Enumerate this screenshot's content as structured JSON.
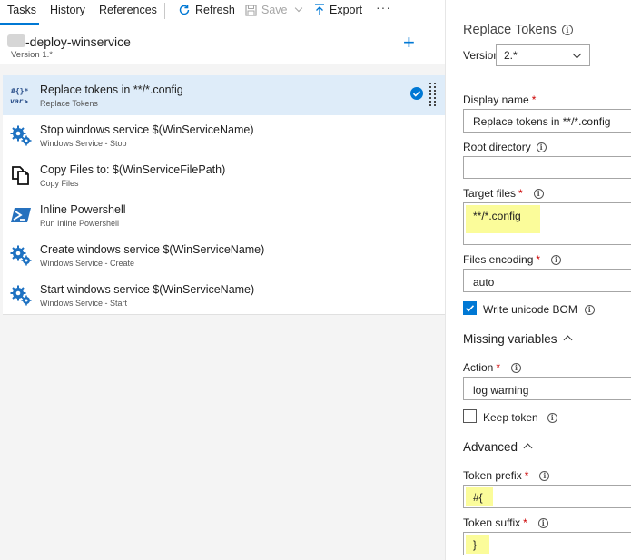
{
  "toolbar": {
    "tabs": [
      {
        "label": "Tasks",
        "active": true
      },
      {
        "label": "History",
        "active": false
      },
      {
        "label": "References",
        "active": false
      }
    ],
    "refresh_label": "Refresh",
    "save_label": "Save",
    "export_label": "Export",
    "more_label": "···"
  },
  "definition": {
    "name": "-deploy-winservice",
    "version": "Version 1.*",
    "add_label": "+"
  },
  "tasks": [
    {
      "title": "Replace tokens in **/*.config",
      "subtitle": "Replace Tokens",
      "icon": "replace-tokens-icon",
      "selected": true
    },
    {
      "title": "Stop windows service $(WinServiceName)",
      "subtitle": "Windows Service - Stop",
      "icon": "gears-icon",
      "selected": false
    },
    {
      "title": "Copy Files to: $(WinServiceFilePath)",
      "subtitle": "Copy Files",
      "icon": "copy-files-icon",
      "selected": false
    },
    {
      "title": "Inline Powershell",
      "subtitle": "Run Inline Powershell",
      "icon": "powershell-icon",
      "selected": false
    },
    {
      "title": "Create windows service $(WinServiceName)",
      "subtitle": "Windows Service - Create",
      "icon": "gears-icon",
      "selected": false
    },
    {
      "title": "Start windows service $(WinServiceName)",
      "subtitle": "Windows Service - Start",
      "icon": "gears-icon",
      "selected": false
    }
  ],
  "details": {
    "title": "Replace Tokens",
    "version_label": "Version",
    "version_value": "2.*",
    "display_name_label": "Display name",
    "display_name_value": "Replace tokens in **/*.config",
    "root_directory_label": "Root directory",
    "root_directory_value": "",
    "target_files_label": "Target files",
    "target_files_value": "**/*.config",
    "files_encoding_label": "Files encoding",
    "files_encoding_value": "auto",
    "write_bom_label": "Write unicode BOM",
    "write_bom_checked": true,
    "missing_variables_label": "Missing variables",
    "action_label": "Action",
    "action_value": "log warning",
    "keep_token_label": "Keep token",
    "keep_token_checked": false,
    "advanced_label": "Advanced",
    "token_prefix_label": "Token prefix",
    "token_prefix_value": "#{",
    "token_suffix_label": "Token suffix",
    "token_suffix_value": "}",
    "required_mark": "*",
    "info_glyph": "i"
  },
  "colors": {
    "accent": "#0078d4",
    "selected_row": "#deecf9",
    "highlight": "#fbfc9a",
    "required": "#cc0000"
  }
}
